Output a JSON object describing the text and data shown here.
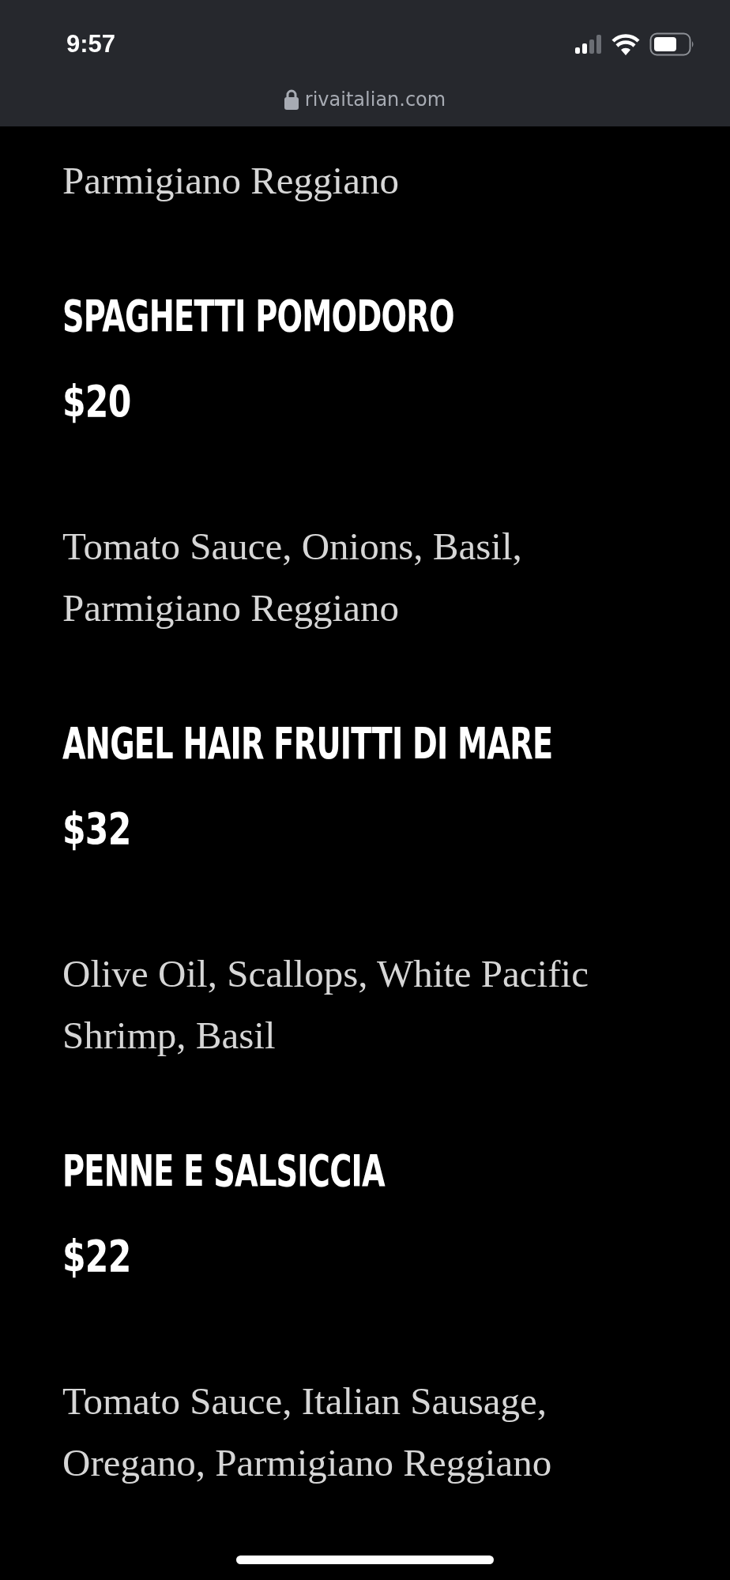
{
  "status_bar": {
    "time": "9:57"
  },
  "browser": {
    "url": "rivaitalian.com"
  },
  "partial_description": [
    "Parmigiano Reggiano"
  ],
  "menu_items": [
    {
      "name": "SPAGHETTI POMODORO",
      "price": "$20",
      "description": [
        "Tomato Sauce, Onions, Basil,",
        "Parmigiano Reggiano"
      ]
    },
    {
      "name": "ANGEL HAIR FRUITTI DI MARE",
      "price": "$32",
      "description": [
        "Olive Oil, Scallops, White Pacific",
        "Shrimp, Basil"
      ]
    },
    {
      "name": "PENNE E SALSICCIA",
      "price": "$22",
      "description": [
        "Tomato Sauce, Italian Sausage,",
        "Oregano, Parmigiano Reggiano"
      ]
    }
  ]
}
